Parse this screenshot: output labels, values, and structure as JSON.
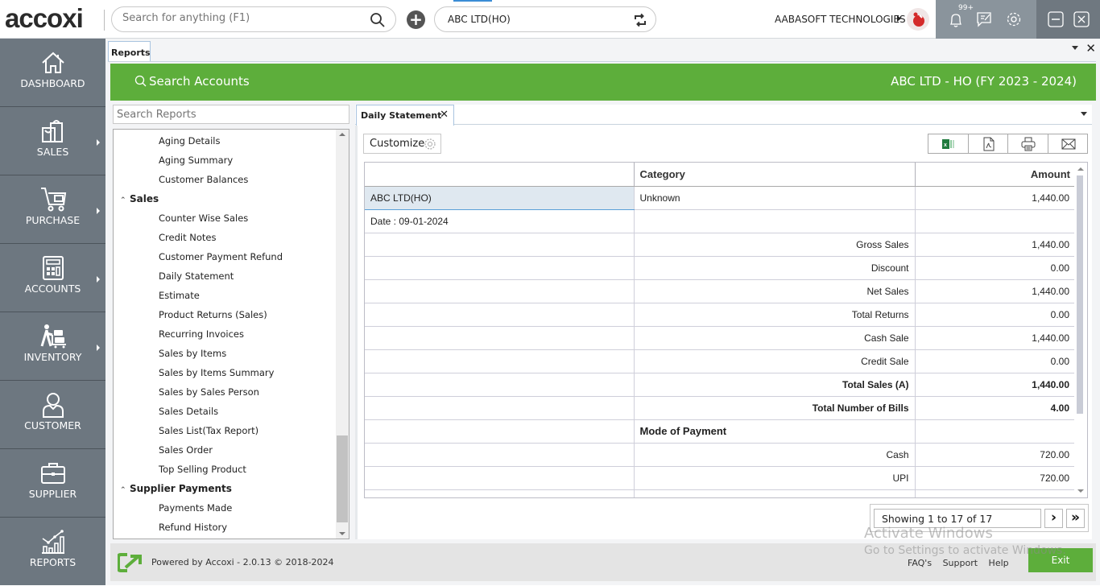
{
  "app": {
    "logo_text": "accoxi",
    "global_search_placeholder": "Search for anything (F1)",
    "company_selector": "ABC LTD(HO)",
    "org_name": "AABASOFT TECHNOLOGIES",
    "notification_badge": "99+",
    "colors": {
      "accent_green": "#5dae3b",
      "sidebar": "#6d7780"
    }
  },
  "sidebar": {
    "items": [
      {
        "label": "DASHBOARD",
        "icon": "home-icon",
        "has_submenu": false
      },
      {
        "label": "SALES",
        "icon": "shopping-bag-icon",
        "has_submenu": true
      },
      {
        "label": "PURCHASE",
        "icon": "cart-icon",
        "has_submenu": true
      },
      {
        "label": "ACCOUNTS",
        "icon": "calculator-icon",
        "has_submenu": true
      },
      {
        "label": "INVENTORY",
        "icon": "trolley-icon",
        "has_submenu": true
      },
      {
        "label": "CUSTOMER",
        "icon": "user-icon",
        "has_submenu": false
      },
      {
        "label": "SUPPLIER",
        "icon": "briefcase-icon",
        "has_submenu": false
      },
      {
        "label": "REPORTS",
        "icon": "chart-icon",
        "has_submenu": false
      }
    ]
  },
  "workspace": {
    "tab_label": "Reports",
    "search_accounts_label": "Search Accounts",
    "company_fy": "ABC LTD - HO (FY 2023 - 2024)",
    "search_reports_placeholder": "Search Reports"
  },
  "report_tree": {
    "items": [
      {
        "type": "item",
        "label": "Aging Details"
      },
      {
        "type": "item",
        "label": "Aging Summary"
      },
      {
        "type": "item",
        "label": "Customer Balances"
      },
      {
        "type": "group",
        "label": "Sales"
      },
      {
        "type": "item",
        "label": "Counter Wise Sales"
      },
      {
        "type": "item",
        "label": "Credit Notes"
      },
      {
        "type": "item",
        "label": "Customer Payment Refund"
      },
      {
        "type": "item",
        "label": "Daily Statement"
      },
      {
        "type": "item",
        "label": "Estimate"
      },
      {
        "type": "item",
        "label": "Product Returns (Sales)"
      },
      {
        "type": "item",
        "label": "Recurring Invoices"
      },
      {
        "type": "item",
        "label": "Sales by Items"
      },
      {
        "type": "item",
        "label": "Sales by Items Summary"
      },
      {
        "type": "item",
        "label": "Sales by Sales Person"
      },
      {
        "type": "item",
        "label": "Sales Details"
      },
      {
        "type": "item",
        "label": "Sales List(Tax Report)"
      },
      {
        "type": "item",
        "label": "Sales Order"
      },
      {
        "type": "item",
        "label": "Top Selling Product"
      },
      {
        "type": "group",
        "label": "Supplier Payments"
      },
      {
        "type": "item",
        "label": "Payments Made"
      },
      {
        "type": "item",
        "label": "Refund History"
      }
    ]
  },
  "report": {
    "tab_label": "Daily Statement",
    "customize_label": "Customize",
    "export_buttons": [
      "excel-icon",
      "pdf-icon",
      "print-icon",
      "email-icon"
    ],
    "columns": [
      "",
      "Category",
      "Amount"
    ],
    "rows": [
      {
        "c1": "ABC LTD(HO)",
        "c2": "Unknown",
        "c3": "1,440.00",
        "style": "selected"
      },
      {
        "c1": "Date : 09-01-2024",
        "c2": "",
        "c3": ""
      },
      {
        "c1": "",
        "c2": "Gross Sales",
        "c3": "1,440.00"
      },
      {
        "c1": "",
        "c2": "Discount",
        "c3": "0.00"
      },
      {
        "c1": "",
        "c2": "Net Sales",
        "c3": "1,440.00"
      },
      {
        "c1": "",
        "c2": "Total Returns",
        "c3": "0.00"
      },
      {
        "c1": "",
        "c2": "Cash Sale",
        "c3": "1,440.00"
      },
      {
        "c1": "",
        "c2": "Credit Sale",
        "c3": "0.00"
      },
      {
        "c1": "",
        "c2": "Total Sales (A)",
        "c3": "1,440.00",
        "style": "bold"
      },
      {
        "c1": "",
        "c2": "Total Number of Bills",
        "c3": "4.00",
        "style": "bold"
      },
      {
        "c1": "",
        "c2": "Mode of Payment",
        "c3": "",
        "style": "heading"
      },
      {
        "c1": "",
        "c2": "Cash",
        "c3": "720.00"
      },
      {
        "c1": "",
        "c2": "UPI",
        "c3": "720.00"
      }
    ],
    "pager_text": "Showing 1 to 17 of 17",
    "next_label": "›",
    "last_label": "»"
  },
  "footer": {
    "powered_by": "Powered by Accoxi - 2.0.13 © 2018-2024",
    "links": [
      "FAQ's",
      "Support",
      "Help"
    ],
    "exit_label": "Exit"
  },
  "watermark": {
    "line1": "Activate Windows",
    "line2": "Go to Settings to activate Windows."
  }
}
